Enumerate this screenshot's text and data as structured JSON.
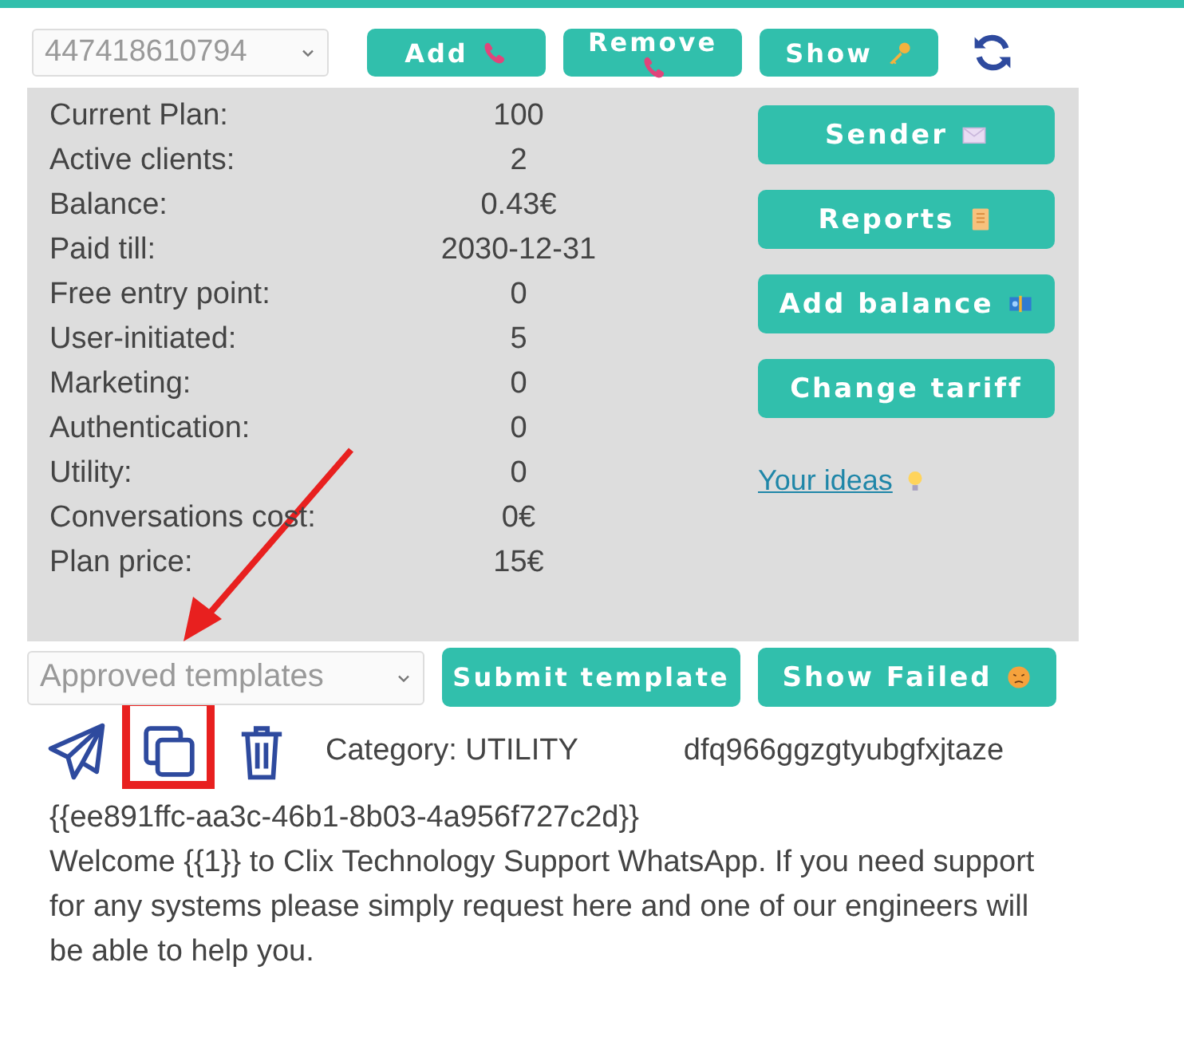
{
  "number_select": {
    "value": "447418610794"
  },
  "top_buttons": [
    {
      "label": "Add"
    },
    {
      "label": "Remove"
    },
    {
      "label": "Show"
    }
  ],
  "stats": [
    {
      "label": "Current Plan:",
      "value": "100"
    },
    {
      "label": "Active clients:",
      "value": "2"
    },
    {
      "label": "Balance:",
      "value": "0.43€"
    },
    {
      "label": "Paid till:",
      "value": "2030-12-31"
    },
    {
      "label": "Free entry point:",
      "value": "0"
    },
    {
      "label": "User-initiated:",
      "value": "5"
    },
    {
      "label": "Marketing:",
      "value": "0"
    },
    {
      "label": "Authentication:",
      "value": "0"
    },
    {
      "label": "Utility:",
      "value": "0"
    },
    {
      "label": "Conversations cost:",
      "value": "0€"
    },
    {
      "label": "Plan price:",
      "value": "15€"
    }
  ],
  "side_buttons": [
    {
      "label": "Sender"
    },
    {
      "label": "Reports"
    },
    {
      "label": "Add balance"
    },
    {
      "label": "Change tariff"
    }
  ],
  "ideas_link": "Your ideas",
  "template_select": {
    "value": "Approved templates"
  },
  "template_buttons": [
    {
      "label": "Submit template"
    },
    {
      "label": "Show Failed"
    }
  ],
  "template": {
    "category": "Category: UTILITY",
    "name": "dfq966ggzgtyubgfxjtaze",
    "id": "{{ee891ffc-aa3c-46b1-8b03-4a956f727c2d}}",
    "body": "Welcome {{1}} to Clix Technology Support WhatsApp. If you need support for any systems please simply request here and one of our engineers will be able to help you."
  }
}
